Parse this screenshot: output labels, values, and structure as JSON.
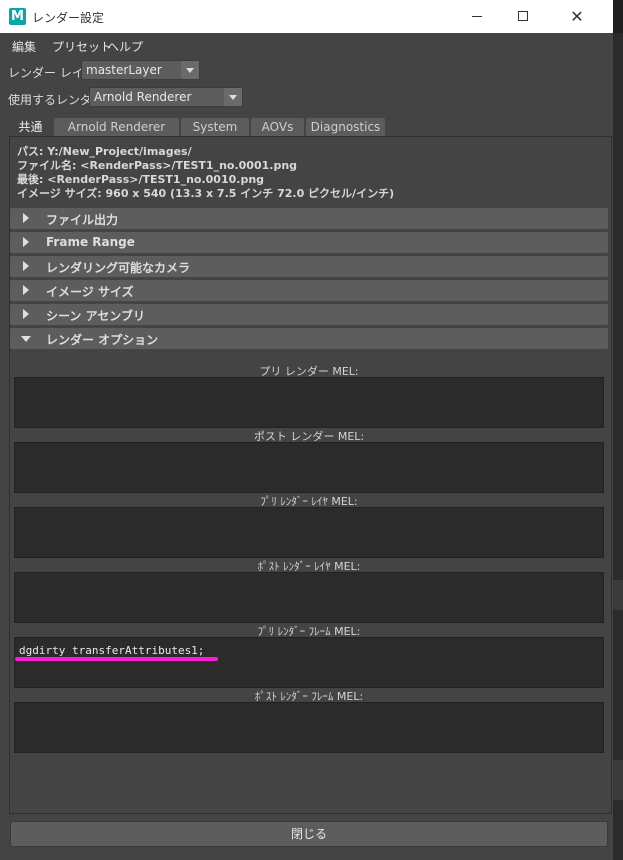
{
  "window": {
    "title": "レンダー設定",
    "app_icon": "M"
  },
  "menu": [
    "編集",
    "プリセット",
    "ヘルプ"
  ],
  "render_layer": {
    "label": "レンダー レイヤ",
    "value": "masterLayer"
  },
  "renderer": {
    "label": "使用するレンダラ",
    "value": "Arnold Renderer"
  },
  "tabs": [
    "共通",
    "Arnold Renderer",
    "System",
    "AOVs",
    "Diagnostics"
  ],
  "active_tab": "共通",
  "info": {
    "path": "パス: Y:/New_Project/images/",
    "filename": "ファイル名: <RenderPass>/TEST1_no.0001.png",
    "last": "最後: <RenderPass>/TEST1_no.0010.png",
    "image_size": "イメージ サイズ: 960 x 540 (13.3 x 7.5 インチ 72.0 ピクセル/インチ)"
  },
  "frames": [
    {
      "label": "ファイル出力",
      "expanded": false
    },
    {
      "label": "Frame Range",
      "expanded": false
    },
    {
      "label": "レンダリング可能なカメラ",
      "expanded": false
    },
    {
      "label": "イメージ サイズ",
      "expanded": false
    },
    {
      "label": "シーン アセンブリ",
      "expanded": false
    },
    {
      "label": "レンダー オプション",
      "expanded": true
    }
  ],
  "mel_fields": [
    {
      "label": "プリ レンダー MEL:",
      "value": ""
    },
    {
      "label": "ポスト レンダー MEL:",
      "value": ""
    },
    {
      "label": "ﾌﾟﾘ ﾚﾝﾀﾞｰ ﾚｲﾔ MEL:",
      "value": ""
    },
    {
      "label": "ﾎﾟｽﾄ ﾚﾝﾀﾞｰ ﾚｲﾔ MEL:",
      "value": ""
    },
    {
      "label": "ﾌﾟﾘ ﾚﾝﾀﾞｰ ﾌﾚｰﾑ MEL:",
      "value": "dgdirty transferAttributes1;"
    },
    {
      "label": "ﾎﾟｽﾄ ﾚﾝﾀﾞｰ ﾌﾚｰﾑ MEL:",
      "value": ""
    }
  ],
  "close_label": "閉じる",
  "colors": {
    "highlight": "#ff19d8",
    "background": "#444444",
    "field": "#2b2b2b",
    "icon": "#0aa5a8"
  }
}
